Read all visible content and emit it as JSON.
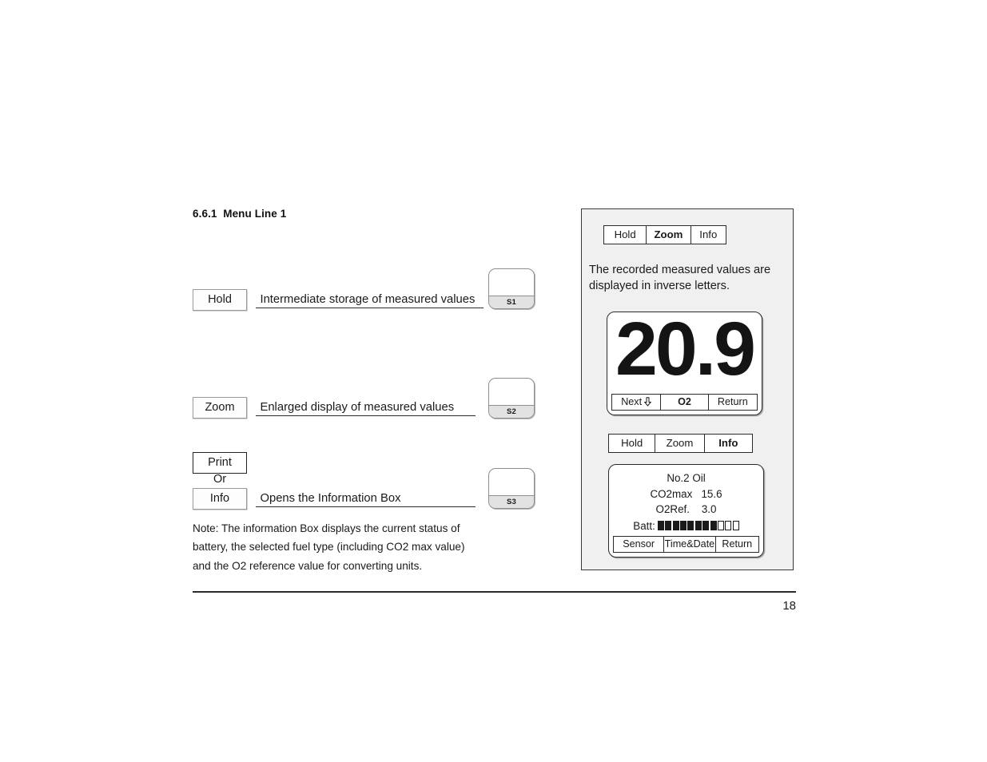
{
  "document": {
    "section_number": "6.6.1",
    "section_title": "Menu Line 1",
    "heading": "6.6.1  Menu Line 1",
    "page_number": "18"
  },
  "flow": {
    "rows": [
      {
        "key_label": "Hold",
        "description": "Intermediate storage of measured values",
        "softkey_label": "S1"
      },
      {
        "key_label": "Zoom",
        "description": "Enlarged display of measured values",
        "softkey_label": "S2"
      },
      {
        "key_label_primary": "Print",
        "or_label": "Or",
        "key_label_secondary": "Info",
        "description": "Opens the Information Box",
        "softkey_label": "S3"
      }
    ]
  },
  "note": {
    "line1": "Note: The information Box displays the current status of",
    "line2": "battery, the selected fuel type (including CO2 max value)",
    "line3": "and the O2 reference value for converting units."
  },
  "panel": {
    "menubar_top": {
      "items": [
        {
          "label": "Hold",
          "selected": false
        },
        {
          "label": "Zoom",
          "selected": true
        },
        {
          "label": "Info",
          "selected": false
        }
      ]
    },
    "caption": {
      "line1": "The recorded measured values are",
      "line2": "displayed in inverse letters."
    },
    "zoom_screen": {
      "value": "20.9",
      "softkeys": [
        {
          "label": "Next",
          "icon": "arrow-down-icon",
          "selected": false
        },
        {
          "label": "O2",
          "selected": true
        },
        {
          "label": "Return",
          "selected": false
        }
      ]
    },
    "menubar_info": {
      "items": [
        {
          "label": "Hold",
          "selected": false
        },
        {
          "label": "Zoom",
          "selected": false
        },
        {
          "label": "Info",
          "selected": true
        }
      ]
    },
    "info_screen": {
      "fuel": "No.2 Oil",
      "co2max_label": "CO2max",
      "co2max_value": "15.6",
      "o2ref_label": "O2Ref.",
      "o2ref_value": "3.0",
      "co2max_line": "CO2max   15.6",
      "o2ref_line": "O2Ref.    3.0",
      "battery_label": "Batt:",
      "battery_filled": 8,
      "battery_empty": 3,
      "softkeys": [
        {
          "label": "Sensor"
        },
        {
          "label": "Time&Date"
        },
        {
          "label": "Return"
        }
      ]
    }
  },
  "colors": {
    "panel_background": "#f0f0f0",
    "panel_border": "#3a3a3a",
    "text": "#1a1a1a",
    "softkey_strip": "#e2e2e2"
  }
}
